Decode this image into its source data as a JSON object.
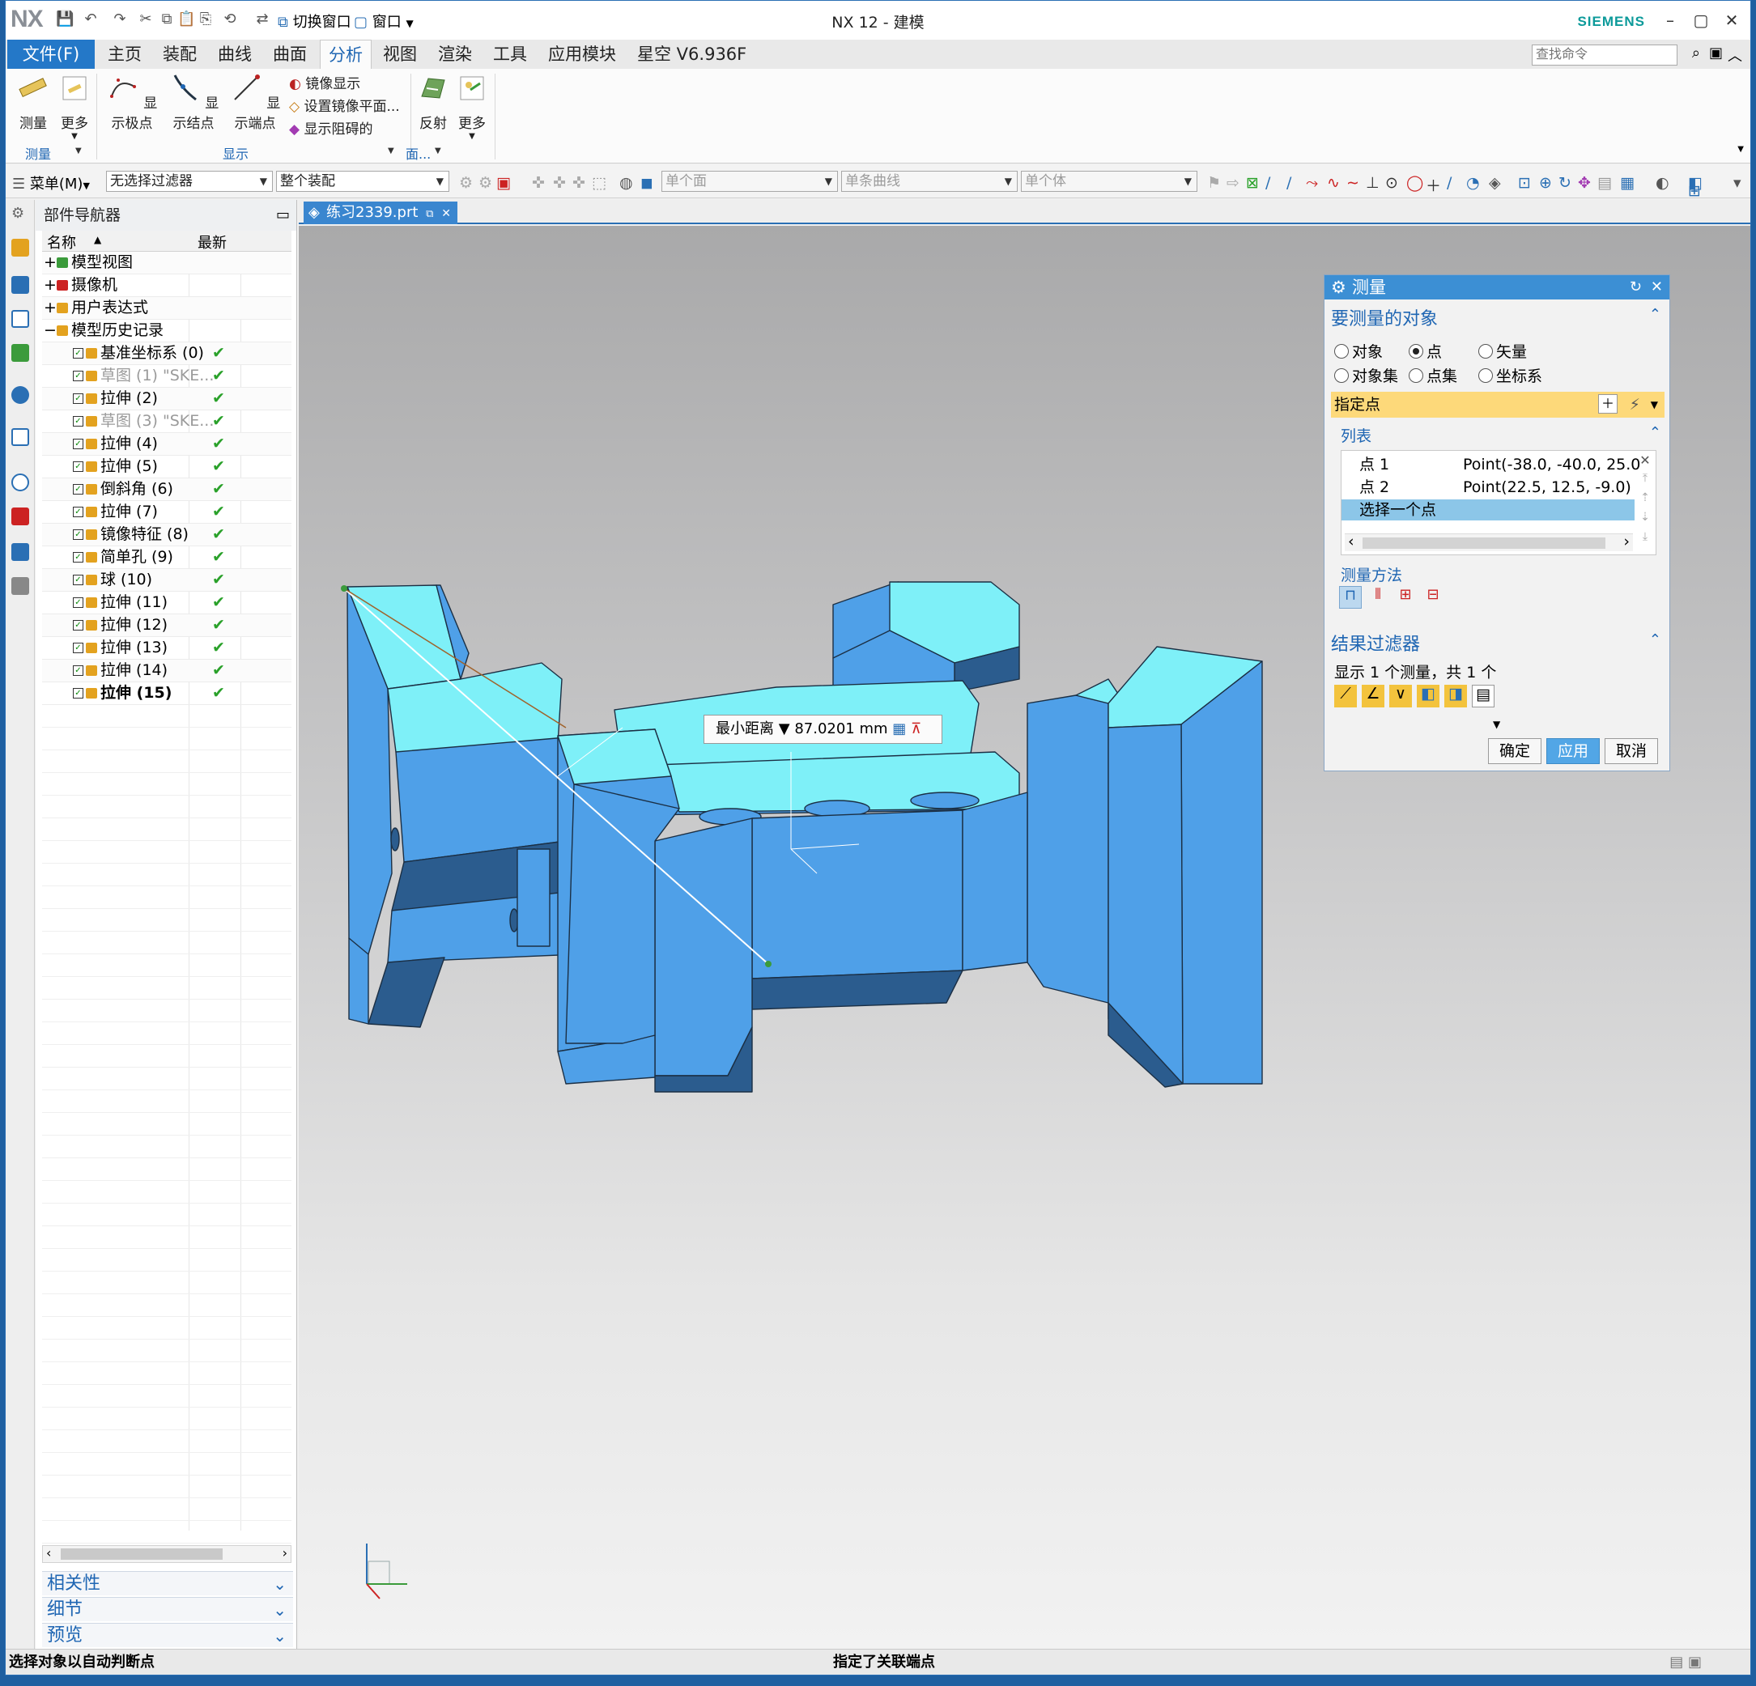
{
  "titlebar": {
    "logo": "NX",
    "title": "NX 12 - 建模",
    "brand": "SIEMENS",
    "switch_window": "切换窗口",
    "window_menu": "窗口"
  },
  "menu": {
    "file": "文件(F)",
    "tabs": [
      "主页",
      "装配",
      "曲线",
      "曲面",
      "分析",
      "视图",
      "渲染",
      "工具",
      "应用模块",
      "星空 V6.936F"
    ],
    "active_tab": "分析",
    "search_placeholder": "查找命令"
  },
  "ribbon": {
    "measure": "测量",
    "more1": "更多",
    "show_poles": "显示极点",
    "show_knots": "显示结点",
    "show_endpoints": "显示端点",
    "mirror_display": "镜像显示",
    "set_mirror_plane": "设置镜像平面...",
    "show_blocking": "显示阻碍的",
    "reflect": "反射",
    "more2": "更多",
    "group_measure": "测量",
    "group_display": "显示",
    "group_face": "面..."
  },
  "selbar": {
    "menu": "菜单(M)",
    "filter": "无选择过滤器",
    "scope": "整个装配",
    "face": "单个面",
    "curve": "单条曲线",
    "body": "单个体"
  },
  "navigator": {
    "title": "部件导航器",
    "col_name": "名称",
    "col_latest": "最新",
    "top_nodes": [
      "模型视图",
      "摄像机",
      "用户表达式",
      "模型历史记录"
    ],
    "features": [
      {
        "name": "基准坐标系 (0)",
        "state": "normal"
      },
      {
        "name": "草图 (1) \"SKE...",
        "state": "dim"
      },
      {
        "name": "拉伸 (2)",
        "state": "normal"
      },
      {
        "name": "草图 (3) \"SKE...",
        "state": "dim"
      },
      {
        "name": "拉伸 (4)",
        "state": "normal"
      },
      {
        "name": "拉伸 (5)",
        "state": "normal"
      },
      {
        "name": "倒斜角 (6)",
        "state": "normal"
      },
      {
        "name": "拉伸 (7)",
        "state": "normal"
      },
      {
        "name": "镜像特征 (8)",
        "state": "normal"
      },
      {
        "name": "简单孔 (9)",
        "state": "normal"
      },
      {
        "name": "球 (10)",
        "state": "normal"
      },
      {
        "name": "拉伸 (11)",
        "state": "normal"
      },
      {
        "name": "拉伸 (12)",
        "state": "normal"
      },
      {
        "name": "拉伸 (13)",
        "state": "normal"
      },
      {
        "name": "拉伸 (14)",
        "state": "normal"
      },
      {
        "name": "拉伸 (15)",
        "state": "bold"
      }
    ],
    "latest_mark": "✔",
    "sections": [
      "相关性",
      "细节",
      "预览"
    ]
  },
  "graphics": {
    "doc_tab": "练习2339.prt",
    "measure_label": "最小距离",
    "measure_value": "87.0201",
    "measure_unit": "mm"
  },
  "dialog": {
    "title": "测量",
    "section_objects": "要测量的对象",
    "radio_options": [
      "对象",
      "点",
      "矢量",
      "对象集",
      "点集",
      "坐标系"
    ],
    "selected_radio": "点",
    "specify_point": "指定点",
    "list_section": "列表",
    "list_rows": [
      {
        "name": "点 1",
        "value": "Point(-38.0, -40.0, 25.0"
      },
      {
        "name": "点 2",
        "value": "Point(22.5, 12.5, -9.0)"
      },
      {
        "name": "选择一个点",
        "value": ""
      }
    ],
    "method_section": "测量方法",
    "result_filter": "结果过滤器",
    "result_summary": "显示 1 个测量，共 1 个",
    "ok": "确定",
    "apply": "应用",
    "cancel": "取消"
  },
  "status": {
    "left": "选择对象以自动判断点",
    "center": "指定了关联端点"
  },
  "colors": {
    "accent": "#2478c8",
    "model_face_light": "#7ef0f8",
    "model_face_mid": "#4fa0e8",
    "model_face_dark": "#2b5c8e",
    "highlight_row": "#fdd97a"
  }
}
